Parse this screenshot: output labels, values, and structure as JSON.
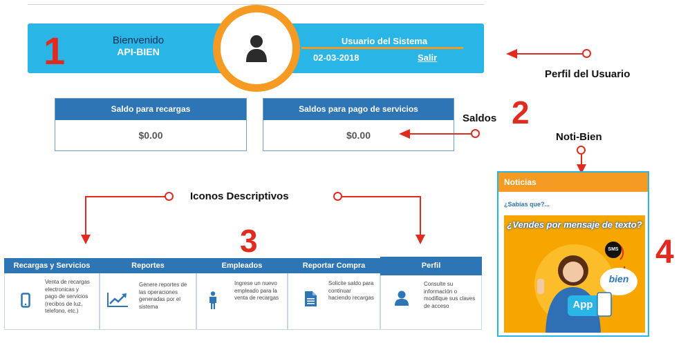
{
  "header": {
    "welcome_label": "Bienvenido",
    "username": "API-BIEN",
    "system_user_label": "Usuario del Sistema",
    "date": "02-03-2018",
    "logout_label": "Salir"
  },
  "annotations": {
    "n1": "1",
    "n2": "2",
    "n3": "3",
    "n4": "4",
    "profile": "Perfil del Usuario",
    "balances": "Saldos",
    "icons": "Iconos Descriptivos",
    "news": "Noti-Bien"
  },
  "balances": [
    {
      "title": "Saldo para recargas",
      "value": "$0.00"
    },
    {
      "title": "Saldos para pago de servicios",
      "value": "$0.00"
    }
  ],
  "cards": [
    {
      "title": "Recargas y Servicios",
      "description": "Venta de recargas electronicas y pago de servicios (recibos de luz, telefono, etc.)",
      "icon": "mobile-phone-icon"
    },
    {
      "title": "Reportes",
      "description": "Genere reportes de las operaciones generadas por el sistema",
      "icon": "chart-trend-icon"
    },
    {
      "title": "Empleados",
      "description": "Ingrese un nuevo empleado para la venta de recargas",
      "icon": "person-icon"
    },
    {
      "title": "Reportar Compra",
      "description": "Solicite saldo para continuar haciendo recargas",
      "icon": "document-icon"
    },
    {
      "title": "Perfil",
      "description": "Consulte su información o modifique sus claves de acceso",
      "icon": "user-icon"
    }
  ],
  "news": {
    "title": "Noticias",
    "subtitle": "¿Sabías que?...",
    "ad": {
      "headline": "¿Vendes por mensaje de texto?",
      "sms_badge": "SMS",
      "brand": "bien",
      "app_label": "App"
    }
  },
  "colors": {
    "banner": "#29b6e6",
    "accent_orange": "#f59a23",
    "header_blue": "#2e75b6",
    "annotation_red": "#e02b20"
  }
}
